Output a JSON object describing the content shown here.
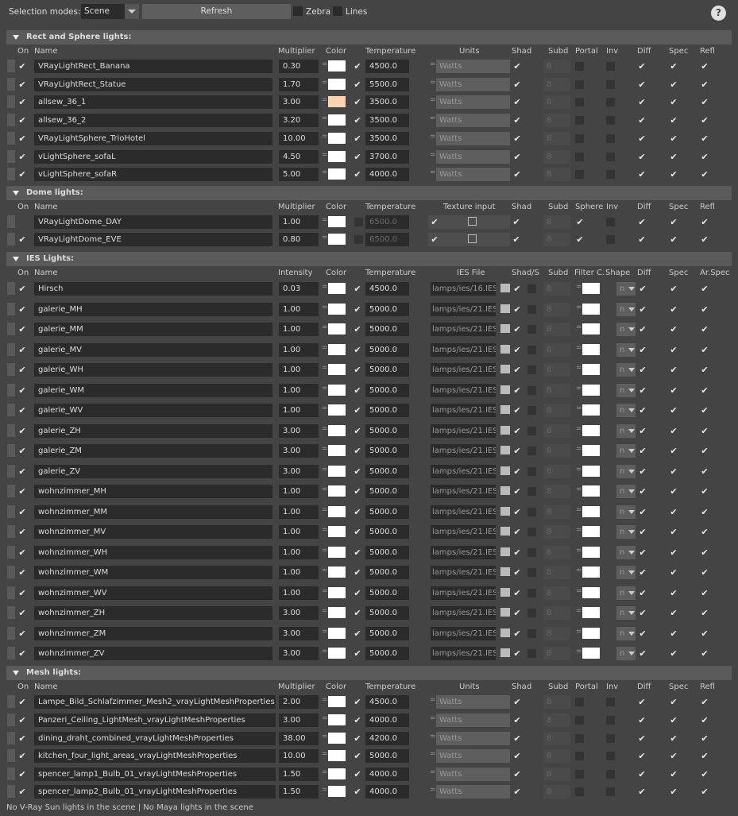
{
  "toolbar": {
    "selection_label": "Selection modes:",
    "selection_value": "Scene",
    "refresh_label": "Refresh",
    "zebra_label": "Zebra",
    "lines_label": "Lines",
    "help_label": "?"
  },
  "sections": {
    "rect": {
      "title": "Rect and Sphere lights:",
      "headers": [
        "On",
        "Name",
        "Multiplier",
        "Color",
        "Temperature",
        "Units",
        "Shad",
        "Subd",
        "Portal",
        "Inv",
        "Diff",
        "Spec",
        "Refl"
      ],
      "rows": [
        {
          "on": true,
          "name": "VRayLightRect_Banana",
          "mult": "0.30",
          "color": "#ffffff",
          "temp": "4500.0",
          "units": "Watts",
          "subd": "8",
          "portal": true
        },
        {
          "on": true,
          "name": "VRayLightRect_Statue",
          "mult": "1.70",
          "color": "#ffffff",
          "temp": "5500.0",
          "units": "Watts",
          "subd": "8",
          "portal": true
        },
        {
          "on": true,
          "name": "allsew_36_1",
          "mult": "3.00",
          "color": "#fcd4b2",
          "temp": "3500.0",
          "units": "Watts",
          "subd": "8",
          "portal": false
        },
        {
          "on": true,
          "name": "allsew_36_2",
          "mult": "3.20",
          "color": "#ffffff",
          "temp": "3500.0",
          "units": "Watts",
          "subd": "8",
          "portal": false
        },
        {
          "on": true,
          "name": "VRayLightSphere_TrioHotel",
          "mult": "10.00",
          "color": "#ffffff",
          "temp": "3500.0",
          "units": "Watts",
          "subd": "8",
          "portal": false
        },
        {
          "on": true,
          "name": "vLightSphere_sofaL",
          "mult": "4.50",
          "color": "#ffffff",
          "temp": "3700.0",
          "units": "Watts",
          "subd": "8",
          "portal": false
        },
        {
          "on": true,
          "name": "vLightSphere_sofaR",
          "mult": "5.00",
          "color": "#ffffff",
          "temp": "4000.0",
          "units": "Watts",
          "subd": "8",
          "portal": false
        }
      ]
    },
    "dome": {
      "title": "Dome lights:",
      "headers": [
        "On",
        "Name",
        "Multiplier",
        "Color",
        "Temperature",
        "Texture input",
        "Shad",
        "Subd",
        "Sphere",
        "Inv",
        "Diff",
        "Spec",
        "Refl"
      ],
      "rows": [
        {
          "on": false,
          "name": "VRayLightDome_DAY",
          "mult": "1.00",
          "temp": "6500.0",
          "subd": "8"
        },
        {
          "on": true,
          "name": "VRayLightDome_EVE",
          "mult": "0.80",
          "temp": "6500.0",
          "subd": "8"
        }
      ]
    },
    "ies": {
      "title": "IES Lights:",
      "headers": [
        "On",
        "Name",
        "Intensity",
        "Color",
        "Temperature",
        "IES File",
        "Shad/S",
        "Subd",
        "Filter C.",
        "Shape",
        "Diff",
        "Spec",
        "Ar.Spec"
      ],
      "rows": [
        {
          "name": "Hirsch",
          "val": "0.03",
          "temp": "4500.0",
          "file": "lamps/ies/16.IES",
          "subd": "8",
          "shape": "n"
        },
        {
          "name": "galerie_MH",
          "val": "1.00",
          "temp": "5000.0",
          "file": "lamps/ies/21.IES",
          "subd": "8",
          "shape": "n"
        },
        {
          "name": "galerie_MM",
          "val": "1.00",
          "temp": "5000.0",
          "file": "lamps/ies/21.IES",
          "subd": "8",
          "shape": "n"
        },
        {
          "name": "galerie_MV",
          "val": "1.00",
          "temp": "5000.0",
          "file": "lamps/ies/21.IES",
          "subd": "8",
          "shape": "n"
        },
        {
          "name": "galerie_WH",
          "val": "1.00",
          "temp": "5000.0",
          "file": "lamps/ies/21.IES",
          "subd": "8",
          "shape": "n"
        },
        {
          "name": "galerie_WM",
          "val": "1.00",
          "temp": "5000.0",
          "file": "lamps/ies/21.IES",
          "subd": "8",
          "shape": "n"
        },
        {
          "name": "galerie_WV",
          "val": "1.00",
          "temp": "5000.0",
          "file": "lamps/ies/21.IES",
          "subd": "8",
          "shape": "n"
        },
        {
          "name": "galerie_ZH",
          "val": "3.00",
          "temp": "5000.0",
          "file": "lamps/ies/21.IES",
          "subd": "8",
          "shape": "n"
        },
        {
          "name": "galerie_ZM",
          "val": "3.00",
          "temp": "5000.0",
          "file": "lamps/ies/21.IES",
          "subd": "8",
          "shape": "n"
        },
        {
          "name": "galerie_ZV",
          "val": "3.00",
          "temp": "5000.0",
          "file": "lamps/ies/21.IES",
          "subd": "8",
          "shape": "n"
        },
        {
          "name": "wohnzimmer_MH",
          "val": "1.00",
          "temp": "5000.0",
          "file": "lamps/ies/21.IES",
          "subd": "8",
          "shape": "n"
        },
        {
          "name": "wohnzimmer_MM",
          "val": "1.00",
          "temp": "5000.0",
          "file": "lamps/ies/21.IES",
          "subd": "8",
          "shape": "n"
        },
        {
          "name": "wohnzimmer_MV",
          "val": "1.00",
          "temp": "5000.0",
          "file": "lamps/ies/21.IES",
          "subd": "8",
          "shape": "n"
        },
        {
          "name": "wohnzimmer_WH",
          "val": "1.00",
          "temp": "5000.0",
          "file": "lamps/ies/21.IES",
          "subd": "8",
          "shape": "n"
        },
        {
          "name": "wohnzimmer_WM",
          "val": "1.00",
          "temp": "5000.0",
          "file": "lamps/ies/21.IES",
          "subd": "8",
          "shape": "n"
        },
        {
          "name": "wohnzimmer_WV",
          "val": "1.00",
          "temp": "5000.0",
          "file": "lamps/ies/21.IES",
          "subd": "8",
          "shape": "n"
        },
        {
          "name": "wohnzimmer_ZH",
          "val": "3.00",
          "temp": "5000.0",
          "file": "lamps/ies/21.IES",
          "subd": "8",
          "shape": "n"
        },
        {
          "name": "wohnzimmer_ZM",
          "val": "3.00",
          "temp": "5000.0",
          "file": "lamps/ies/21.IES",
          "subd": "8",
          "shape": "n"
        },
        {
          "name": "wohnzimmer_ZV",
          "val": "3.00",
          "temp": "5000.0",
          "file": "lamps/ies/21.IES",
          "subd": "8",
          "shape": "n"
        }
      ]
    },
    "mesh": {
      "title": "Mesh lights:",
      "headers": [
        "On",
        "Name",
        "Multiplier",
        "Color",
        "Temperature",
        "Units",
        "Shad",
        "Subd",
        "Portal",
        "Inv",
        "Diff",
        "Spec",
        "Refl"
      ],
      "rows": [
        {
          "name": "Lampe_Bild_Schlafzimmer_Mesh2_vrayLightMeshProperties",
          "mult": "2.00",
          "temp": "4500.0",
          "units": "Watts",
          "subd": "8"
        },
        {
          "name": "Panzeri_Ceiling_LightMesh_vrayLightMeshProperties",
          "mult": "3.00",
          "temp": "4000.0",
          "units": "Watts",
          "subd": "8"
        },
        {
          "name": "dining_draht_combined_vrayLightMeshProperties",
          "mult": "38.00",
          "temp": "4200.0",
          "units": "Watts",
          "subd": "8"
        },
        {
          "name": "kitchen_four_light_areas_vrayLightMeshProperties",
          "mult": "10.00",
          "temp": "5000.0",
          "units": "Watts",
          "subd": "8"
        },
        {
          "name": "spencer_lamp1_Bulb_01_vrayLightMeshProperties",
          "mult": "1.50",
          "temp": "4000.0",
          "units": "Watts",
          "subd": "8"
        },
        {
          "name": "spencer_lamp2_Bulb_01_vrayLightMeshProperties",
          "mult": "1.50",
          "temp": "4000.0",
          "units": "Watts",
          "subd": "8"
        }
      ]
    }
  },
  "footer": "No V-Ray Sun lights in the scene | No Maya lights in the scene"
}
